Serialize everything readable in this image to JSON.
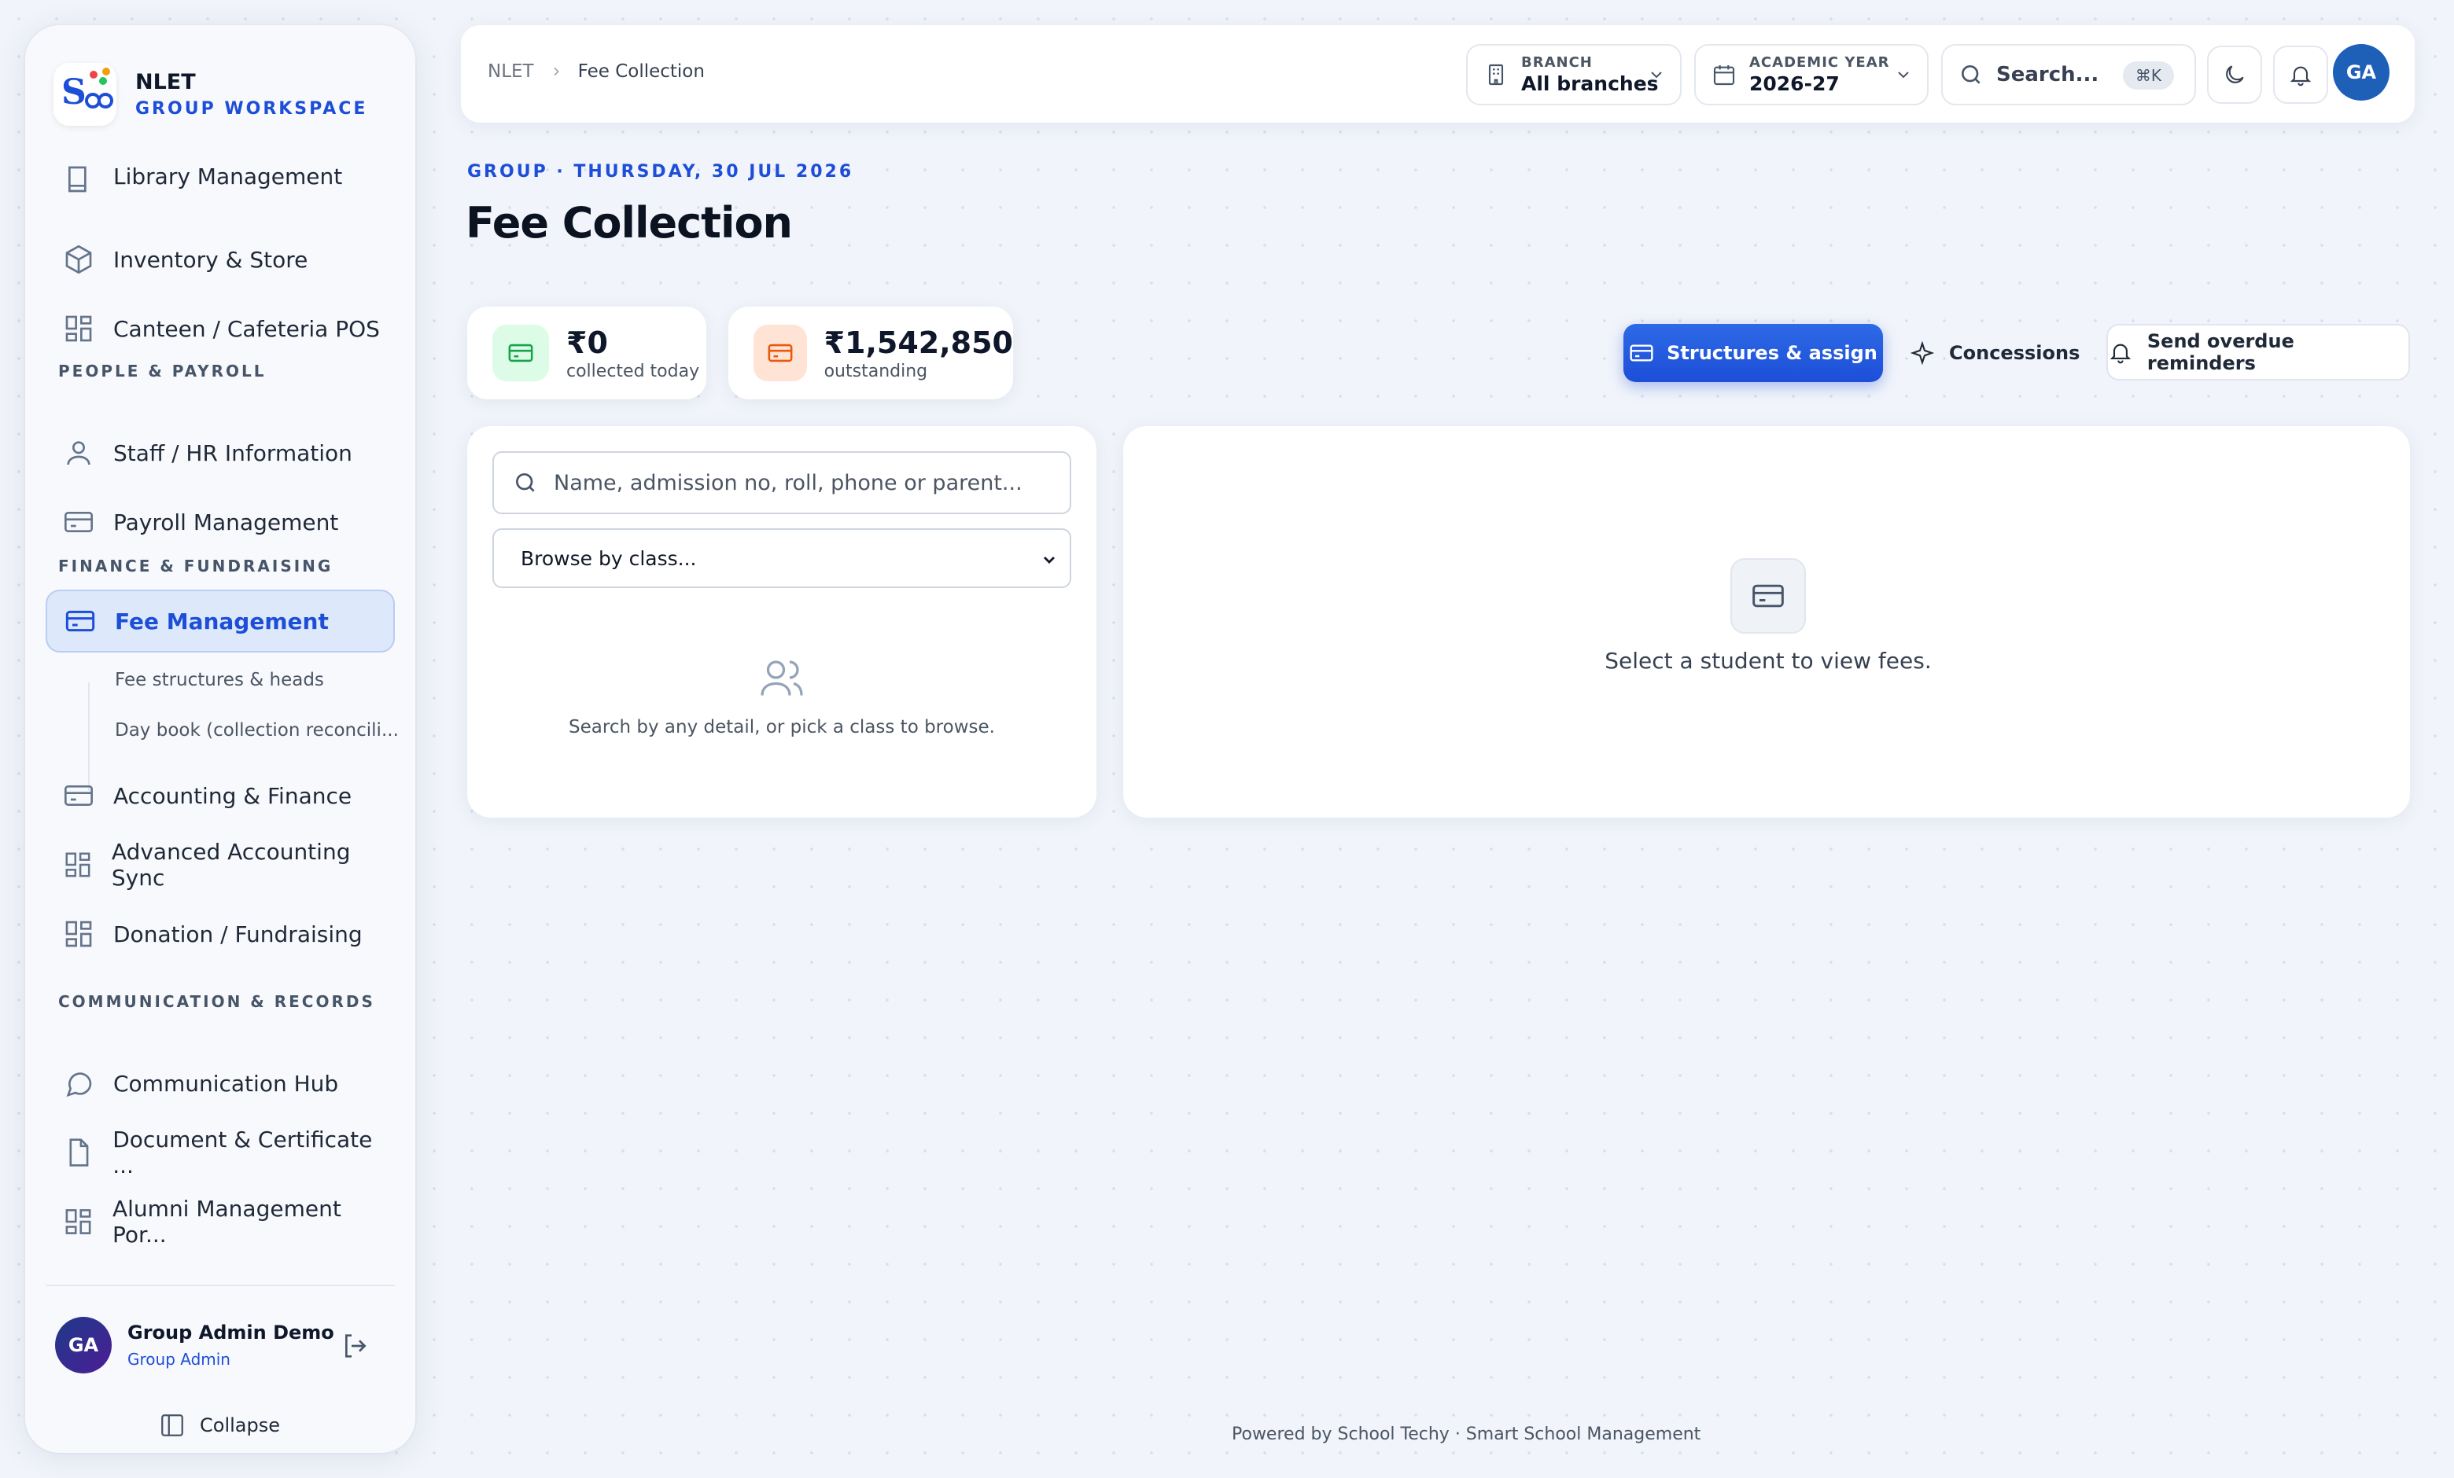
{
  "brand": {
    "name": "NLET",
    "subtitle": "GROUP WORKSPACE"
  },
  "sidebar": {
    "items": [
      {
        "label": "Library Management",
        "icon": "book-icon"
      },
      {
        "label": "Inventory & Store",
        "icon": "box-icon"
      },
      {
        "label": "Canteen / Cafeteria POS",
        "icon": "grid-icon"
      },
      {
        "label": "Staff / HR Information",
        "icon": "person-icon"
      },
      {
        "label": "Payroll Management",
        "icon": "card-icon"
      },
      {
        "label": "Fee Management",
        "icon": "card-icon",
        "active": true
      },
      {
        "label": "Accounting & Finance",
        "icon": "card-icon"
      },
      {
        "label": "Advanced Accounting Sync",
        "icon": "grid-icon"
      },
      {
        "label": "Donation / Fundraising",
        "icon": "grid-icon"
      },
      {
        "label": "Communication Hub",
        "icon": "chat-icon"
      },
      {
        "label": "Document & Certificate ...",
        "icon": "document-icon"
      },
      {
        "label": "Alumni Management Por...",
        "icon": "grid-icon"
      }
    ],
    "sections": [
      "PEOPLE & PAYROLL",
      "FINANCE & FUNDRAISING",
      "COMMUNICATION & RECORDS"
    ],
    "sub_items": [
      "Fee structures & heads",
      "Day book (collection reconcili..."
    ],
    "user": {
      "initials": "GA",
      "name": "Group Admin Demo",
      "role": "Group Admin"
    },
    "collapse_label": "Collapse"
  },
  "topbar": {
    "breadcrumb": [
      "NLET",
      "Fee Collection"
    ],
    "branch": {
      "label": "BRANCH",
      "value": "All branches"
    },
    "year": {
      "label": "ACADEMIC YEAR",
      "value": "2026-27"
    },
    "search": {
      "placeholder": "Search...",
      "shortcut": "⌘K"
    },
    "avatar_initials": "GA"
  },
  "main": {
    "eyebrow": "GROUP · THURSDAY, 30 JUL 2026",
    "title": "Fee Collection",
    "stats": [
      {
        "amount": "₹0",
        "caption": "collected today",
        "color": "#16a34a"
      },
      {
        "amount": "₹1,542,850",
        "caption": "outstanding",
        "color": "#ea580c"
      }
    ],
    "actions": {
      "primary": "Structures & assign",
      "concessions": "Concessions",
      "reminders": "Send overdue reminders"
    },
    "student_search": {
      "placeholder": "Name, admission no, roll, phone or parent...",
      "class_select": "Browse by class...",
      "empty_text": "Search by any detail, or pick a class to browse."
    },
    "fee_panel": {
      "empty_text": "Select a student to view fees."
    }
  },
  "footer": "Powered by School Techy · Smart School Management",
  "colors": {
    "accent": "#1d4ed8",
    "active_bg": "#dde8fb"
  }
}
